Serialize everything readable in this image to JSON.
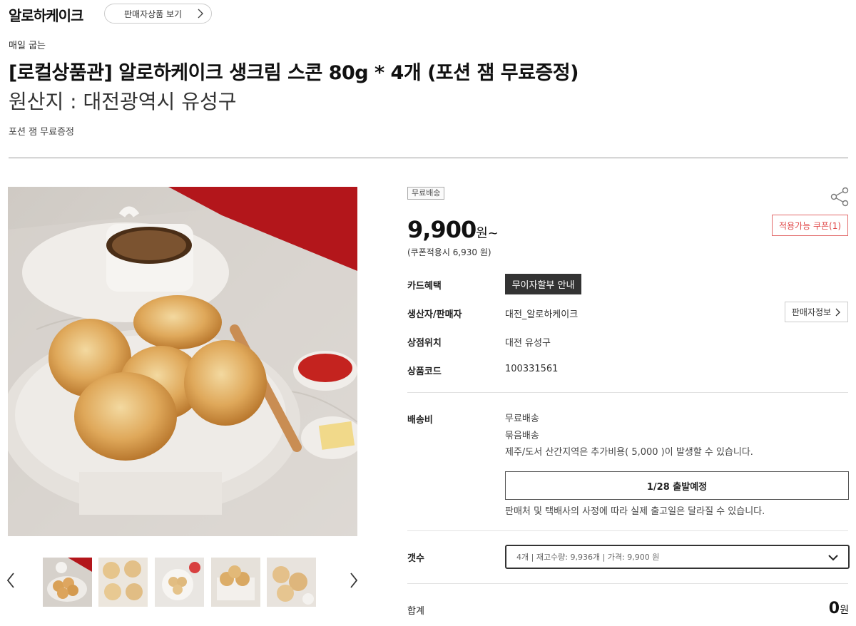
{
  "header": {
    "store_name": "알로하케이크",
    "seller_products_button": "판매자상품 보기"
  },
  "product": {
    "subtitle": "매일 굽는",
    "title": "[로컬상품관] 알로하케이크 생크림 스콘 80g * 4개 (포션 잼 무료증정)",
    "origin": "원산지 : 대전광역시 유성구",
    "description": "포션 잼 무료증정"
  },
  "thumbnails": {
    "prev_icon": "chevron-left-icon",
    "next_icon": "chevron-right-icon",
    "count": 5
  },
  "purchase": {
    "shipping_badge": "무료배송",
    "share_icon": "share-icon",
    "price_number": "9,900",
    "price_unit": "원~",
    "coupon_price": "(쿠폰적용시 6,930 원)",
    "coupon_button": "적용가능 쿠폰(1)"
  },
  "info": {
    "card_label": "카드혜택",
    "card_button": "무이자할부 안내",
    "seller_label": "생산자/판매자",
    "seller_value": "대전_알로하케이크",
    "seller_info_button": "판매자정보",
    "location_label": "상점위치",
    "location_value": "대전 유성구",
    "code_label": "상품코드",
    "code_value": "100331561"
  },
  "shipping": {
    "label": "배송비",
    "line1": "무료배송",
    "line2": "묶음배송",
    "line3": "제주/도서 산간지역은 추가비용( 5,000 )이 발생할 수 있습니다.",
    "dispatch": "1/28 출발예정",
    "note": "판매처 및 택배사의 사정에 따라 실제 출고일은 달라질 수 있습니다."
  },
  "quantity": {
    "label": "갯수",
    "selected": "4개 | 재고수량: 9,936개 | 가격: 9,900 원"
  },
  "total": {
    "label": "합계",
    "value": "0",
    "unit": "원"
  },
  "colors": {
    "accent_red": "#e04848",
    "dark_button": "#333333"
  }
}
